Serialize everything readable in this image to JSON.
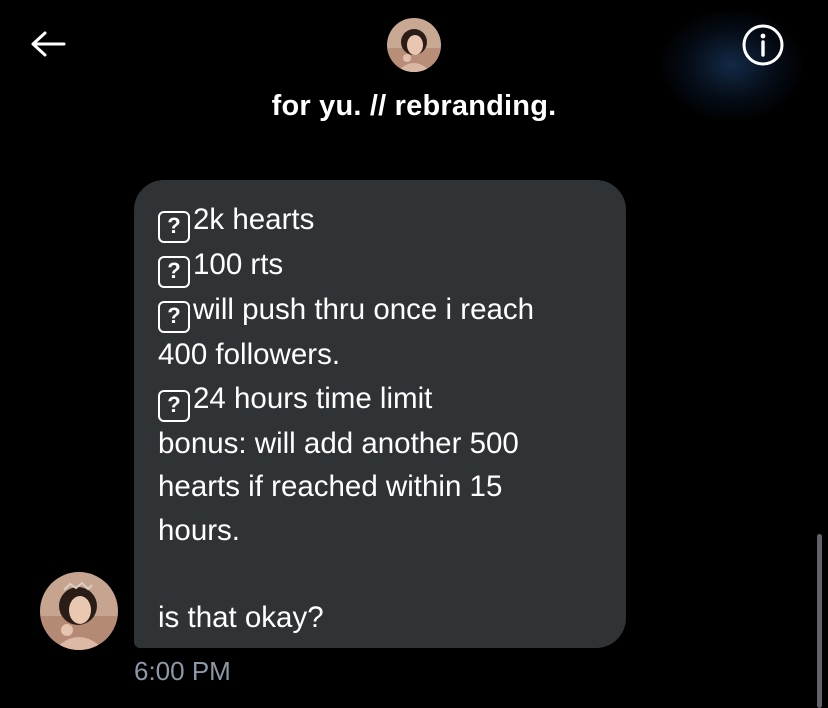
{
  "header": {
    "title": "for yu. // rebranding.",
    "back_icon": "arrow-left-icon",
    "info_icon": "info-circle-icon"
  },
  "message": {
    "lines": [
      {
        "prefix": "?",
        "text": "2k hearts"
      },
      {
        "prefix": "?",
        "text": "100 rts"
      },
      {
        "prefix": "?",
        "text": "will push thru once i reach"
      },
      {
        "prefix": "",
        "text": "400 followers."
      },
      {
        "prefix": "?",
        "text": "24 hours time limit"
      },
      {
        "prefix": "",
        "text": "bonus: will add another 500"
      },
      {
        "prefix": "",
        "text": "hearts if reached within 15"
      },
      {
        "prefix": "",
        "text": "hours."
      },
      {
        "prefix": "",
        "text": ""
      },
      {
        "prefix": "",
        "text": "is that okay?"
      }
    ],
    "timestamp": "6:00 PM"
  },
  "colors": {
    "background": "#000000",
    "bubble": "#2f3336",
    "text": "#ffffff",
    "muted": "#8b98a5"
  }
}
